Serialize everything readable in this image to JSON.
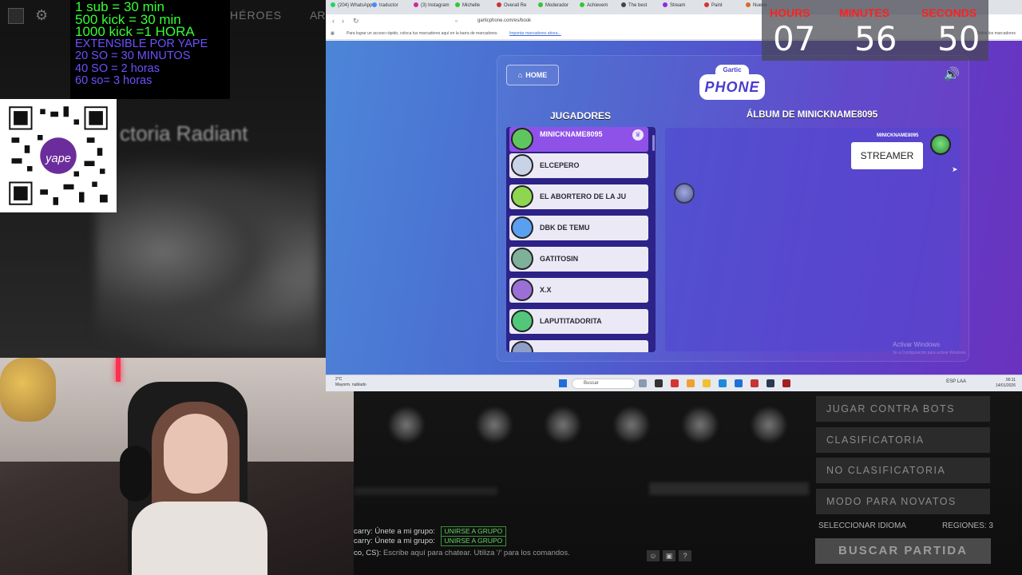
{
  "stream": {
    "rates": {
      "green": [
        "1 sub = 30 min",
        "500 kick = 30 min",
        "1000 kick =1 HORA"
      ],
      "purple": [
        "EXTENSIBLE POR   YAPE",
        "20 SO = 30 MINUTOS",
        "40 SO = 2 horas",
        "60 so= 3 horas"
      ]
    },
    "qr_label": "yape",
    "bg_game": {
      "nav_heroes": "HÉROES",
      "nav_ar": "AR",
      "victory_text": "ctoria Radiant"
    }
  },
  "timer": {
    "labels": {
      "hours": "HOURS",
      "minutes": "MINUTES",
      "seconds": "SECONDS"
    },
    "values": {
      "hours": "07",
      "minutes": "56",
      "seconds": "50"
    },
    "accent_color": "#ff2020"
  },
  "browser": {
    "tabs": [
      "(204) WhatsApp",
      "traductor",
      "(3) Instagram",
      "Michelle",
      "Overall Re",
      "Moderador",
      "Achievem",
      "The best",
      "Stream",
      "Paint",
      "Nuevo"
    ],
    "url": "garticphone.com/es/book",
    "bookmarks_hint": "Para lograr un acceso rápido, coloca tus marcadores aquí en la barra de marcadores.",
    "bookmarks_link": "Importar marcadores ahora...",
    "bookmarks_right": "Todos los marcadores"
  },
  "gartic": {
    "home_label": "HOME",
    "logo_top": "Gartic",
    "logo_main": "PHONE",
    "players_title": "JUGADORES",
    "album_title": "ÁLBUM DE MINICKNAME8095",
    "players": [
      {
        "name": "MINICKNAME8095",
        "active": true,
        "avatar_color": "#5fc65f"
      },
      {
        "name": "ELCEPERO",
        "active": false,
        "avatar_color": "#c9d3e8"
      },
      {
        "name": "EL ABORTERO DE LA JU",
        "active": false,
        "avatar_color": "#8ed64f"
      },
      {
        "name": "DBK DE TEMU",
        "active": false,
        "avatar_color": "#5aa0f0"
      },
      {
        "name": "GATITOSIN",
        "active": false,
        "avatar_color": "#7fb09a"
      },
      {
        "name": "X.X",
        "active": false,
        "avatar_color": "#9a70d6"
      },
      {
        "name": "LAPUTITADORITA",
        "active": false,
        "avatar_color": "#52c67a"
      }
    ],
    "album_entry": {
      "author": "MINICKNAME8095",
      "text": "STREAMER"
    },
    "watermark": {
      "line1": "Activar Windows",
      "line2": "Ve a Configuración para activar Windows."
    }
  },
  "taskbar": {
    "weather_temp": "2°C",
    "weather_desc": "Mayorm. nublado",
    "search_placeholder": "Buscar",
    "lang": "ESP\nLAA",
    "time": "00:11",
    "date": "14/01/2026"
  },
  "dota": {
    "menu": [
      "JUGAR CONTRA BOTS",
      "CLASIFICATORIA",
      "NO CLASIFICATORIA",
      "MODO PARA NOVATOS"
    ],
    "language_label": "SELECCIONAR IDIOMA",
    "regions_label": "REGIONES: 3",
    "find_match": "BUSCAR PARTIDA",
    "chat": [
      {
        "user": "carry:",
        "text": "Únete a mi grupo:",
        "button": "UNIRSE A GRUPO"
      },
      {
        "user": "carry:",
        "text": "Únete a mi grupo:",
        "button": "UNIRSE A GRUPO"
      }
    ],
    "chat_prefix": "co, CS):",
    "chat_placeholder": "Escribe aquí para chatear. Utiliza '/' para los comandos."
  }
}
